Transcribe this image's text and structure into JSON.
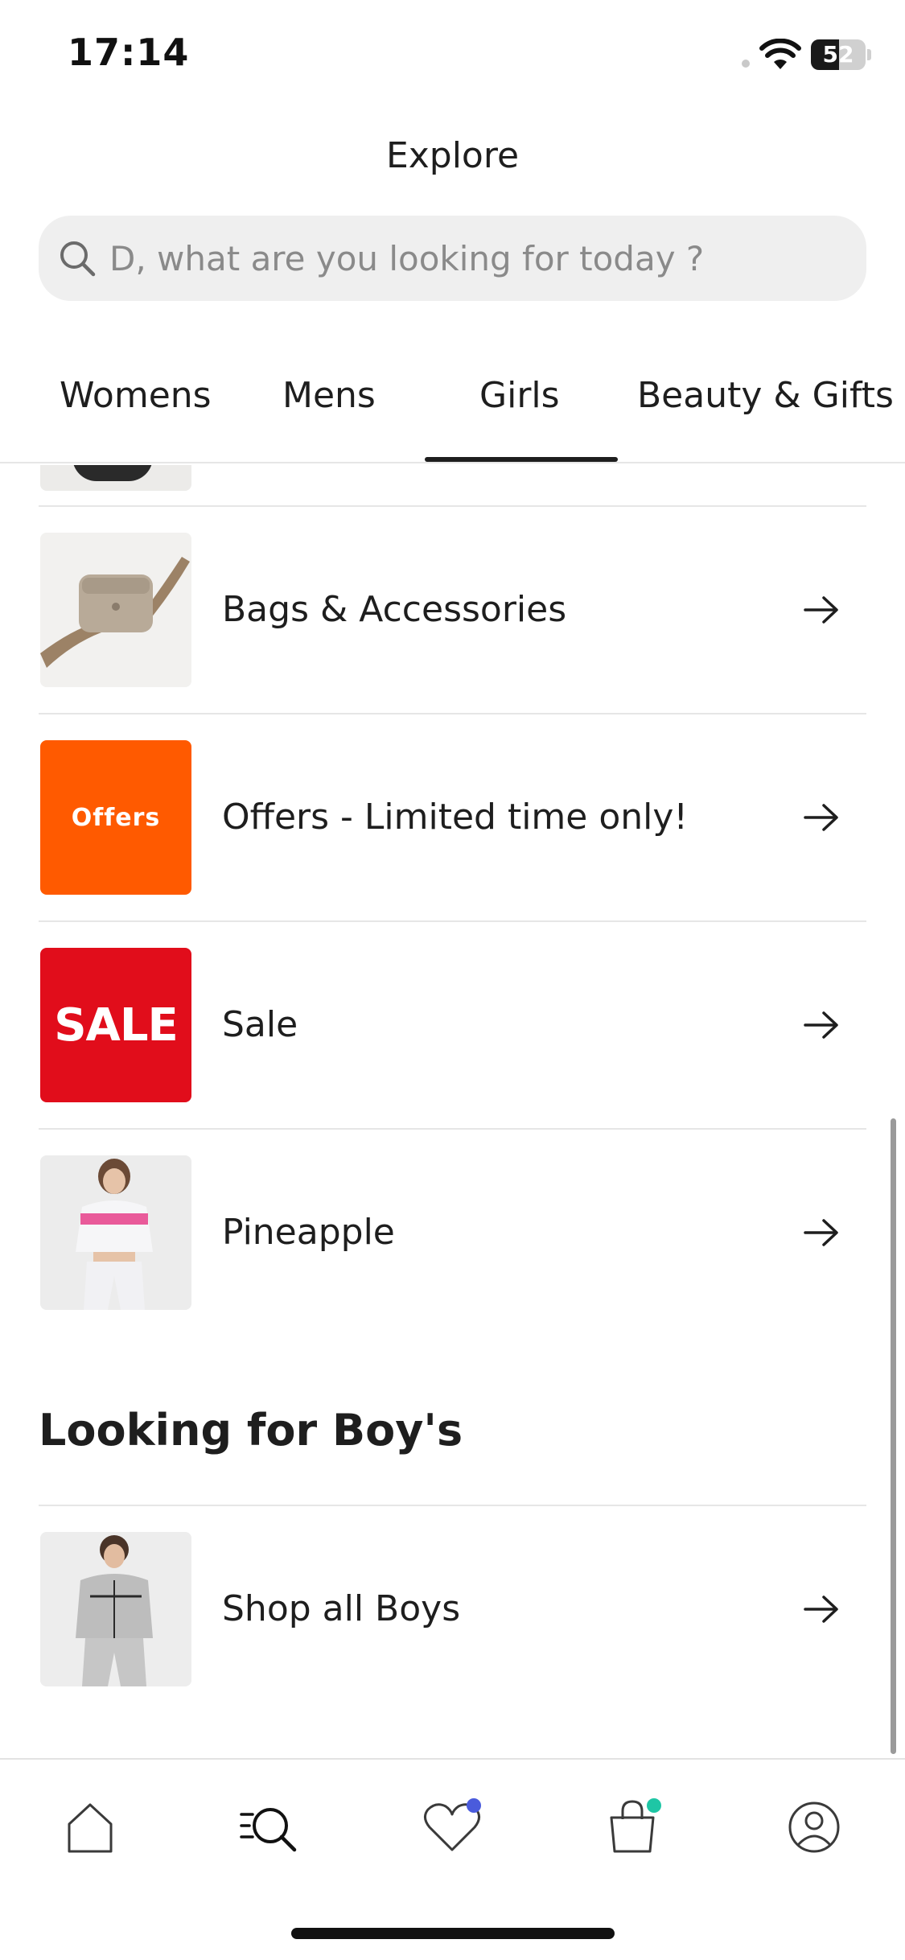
{
  "status_bar": {
    "time": "17:14",
    "battery_level": 52,
    "battery_text": "52"
  },
  "header": {
    "title": "Explore"
  },
  "search": {
    "placeholder": "D, what are you looking for today ?",
    "value": ""
  },
  "tabs": [
    {
      "label": "Womens",
      "active": false
    },
    {
      "label": "Mens",
      "active": false
    },
    {
      "label": "Girls",
      "active": true
    },
    {
      "label": "Beauty & Gifts",
      "active": false
    }
  ],
  "list": {
    "items": [
      {
        "label": "Bags & Accessories",
        "thumb": "bag-image",
        "thumb_text": ""
      },
      {
        "label": "Offers - Limited time only!",
        "thumb": "offers-tile",
        "thumb_text": "Offers"
      },
      {
        "label": "Sale",
        "thumb": "sale-tile",
        "thumb_text": "SALE"
      },
      {
        "label": "Pineapple",
        "thumb": "girl-model-image",
        "thumb_text": ""
      }
    ]
  },
  "boys_section": {
    "heading": "Looking for Boy's",
    "items": [
      {
        "label": "Shop all Boys",
        "thumb": "boy-model-image"
      }
    ]
  },
  "bottom_nav": {
    "items": [
      {
        "icon": "home-icon",
        "active": false
      },
      {
        "icon": "explore-search-icon",
        "active": true
      },
      {
        "icon": "heart-icon",
        "active": false,
        "badge_color": "#4a5bdc"
      },
      {
        "icon": "bag-icon",
        "active": false,
        "badge_color": "#1ec6a5"
      },
      {
        "icon": "profile-icon",
        "active": false
      }
    ]
  },
  "colors": {
    "offers_orange": "#ff5a00",
    "sale_red": "#e10d1b",
    "text": "#1e1e1e"
  }
}
